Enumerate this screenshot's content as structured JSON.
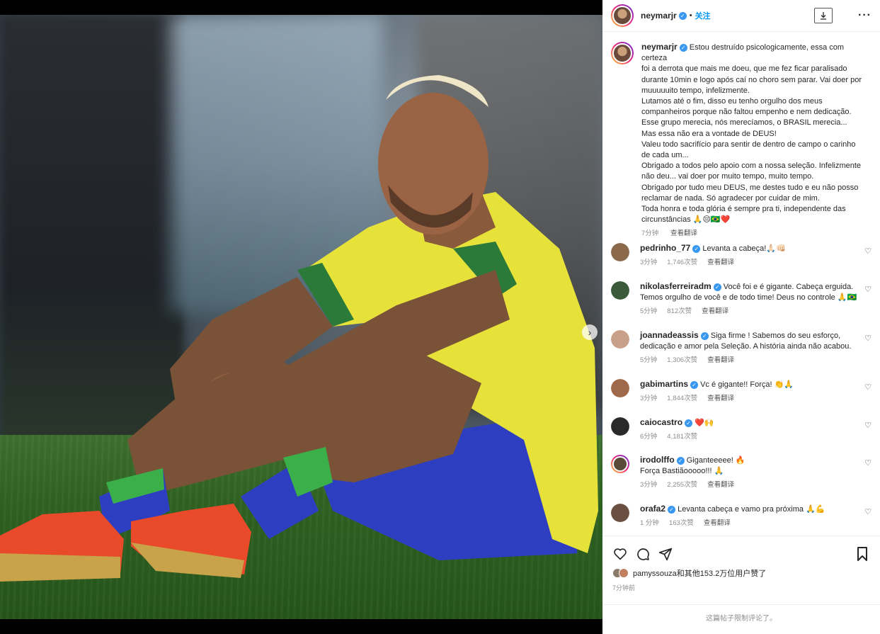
{
  "post": {
    "author": "neymarjr",
    "follow_label": "关注",
    "separator": "•",
    "carousel_dots": 2,
    "carousel_active": 0
  },
  "caption": {
    "author": "neymarjr",
    "lines": [
      "Estou destruído psicologicamente, essa com certeza",
      "foi a derrota que mais me doeu, que me fez ficar paralisado",
      "durante 10min e logo após caí no choro sem parar. Vai doer por",
      "muuuuuito tempo, infelizmente.",
      "Lutamos até o fim, disso eu tenho orgulho dos meus",
      "companheiros porque não faltou empenho e nem dedicação.",
      "Esse grupo merecia, nós merecíamos, o BRASIL merecia...",
      "Mas essa não era a vontade de DEUS!",
      "Valeu todo sacrifício para sentir de dentro de campo o carinho",
      "de cada um...",
      "Obrigado a todos pelo apoio com a nossa seleção. Infelizmente",
      "não deu... vai doer por muito tempo, muito tempo.",
      "Obrigado por tudo meu DEUS, me destes tudo e eu não posso",
      "reclamar de nada. Só agradecer por cuidar de mim.",
      "Toda honra e toda glória é sempre pra ti, independente das",
      "circunstâncias 🙏😔🇧🇷❤️"
    ],
    "time": "7分钟",
    "translate": "查看翻译"
  },
  "comments": [
    {
      "user": "pedrinho_77",
      "verified": true,
      "lines": [
        "Levanta a cabeça!🙏🏻👊🏻"
      ],
      "time": "3分钟",
      "likes": "1,746次赞",
      "translate": "查看翻译",
      "avatar_color": "#8a6a4a"
    },
    {
      "user": "nikolasferreiradm",
      "verified": true,
      "lines": [
        "Você foi e é gigante. Cabeça erguida.",
        "Temos orgulho de você e de todo time! Deus no controle 🙏🇧🇷"
      ],
      "time": "5分钟",
      "likes": "812次赞",
      "translate": "查看翻译",
      "avatar_color": "#3a5a3a"
    },
    {
      "user": "joannadeassis",
      "verified": true,
      "lines": [
        "Siga firme ! Sabemos do seu esforço,",
        "dedicação e amor pela Seleção. A história ainda não acabou."
      ],
      "time": "5分钟",
      "likes": "1,306次赞",
      "translate": "查看翻译",
      "avatar_color": "#c9a08a"
    },
    {
      "user": "gabimartins",
      "verified": true,
      "lines": [
        "Vc é gigante!! Força! 👏🙏"
      ],
      "time": "3分钟",
      "likes": "1,844次赞",
      "translate": "查看翻译",
      "avatar_color": "#a0684a"
    },
    {
      "user": "caiocastro",
      "verified": true,
      "lines": [
        "❤️🙌"
      ],
      "time": "6分钟",
      "likes": "4,181次赞",
      "translate": "",
      "avatar_color": "#2a2a2a"
    },
    {
      "user": "irodolffo",
      "verified": true,
      "lines": [
        "Giganteeeee! 🔥",
        "Força Bastiãooooo!!! 🙏"
      ],
      "time": "3分钟",
      "likes": "2,255次赞",
      "translate": "查看翻译",
      "avatar_color": "#5a4a3a"
    },
    {
      "user": "orafa2",
      "verified": true,
      "lines": [
        "Levanta cabeça e vamo pra próxima 🙏💪"
      ],
      "time": "1 分钟",
      "likes": "163次赞",
      "translate": "查看翻译",
      "avatar_color": "#6a5040"
    }
  ],
  "actions": {
    "likes_text": "pamyssouza和其他153.2万位用户赞了",
    "posted": "7分钟前",
    "comments_limited": "这篇帖子限制评论了。"
  },
  "colors": {
    "accent": "#0095f6",
    "verified": "#3897f0",
    "jersey_yellow": "#e7e23a",
    "shorts_blue": "#2d3fc0"
  }
}
